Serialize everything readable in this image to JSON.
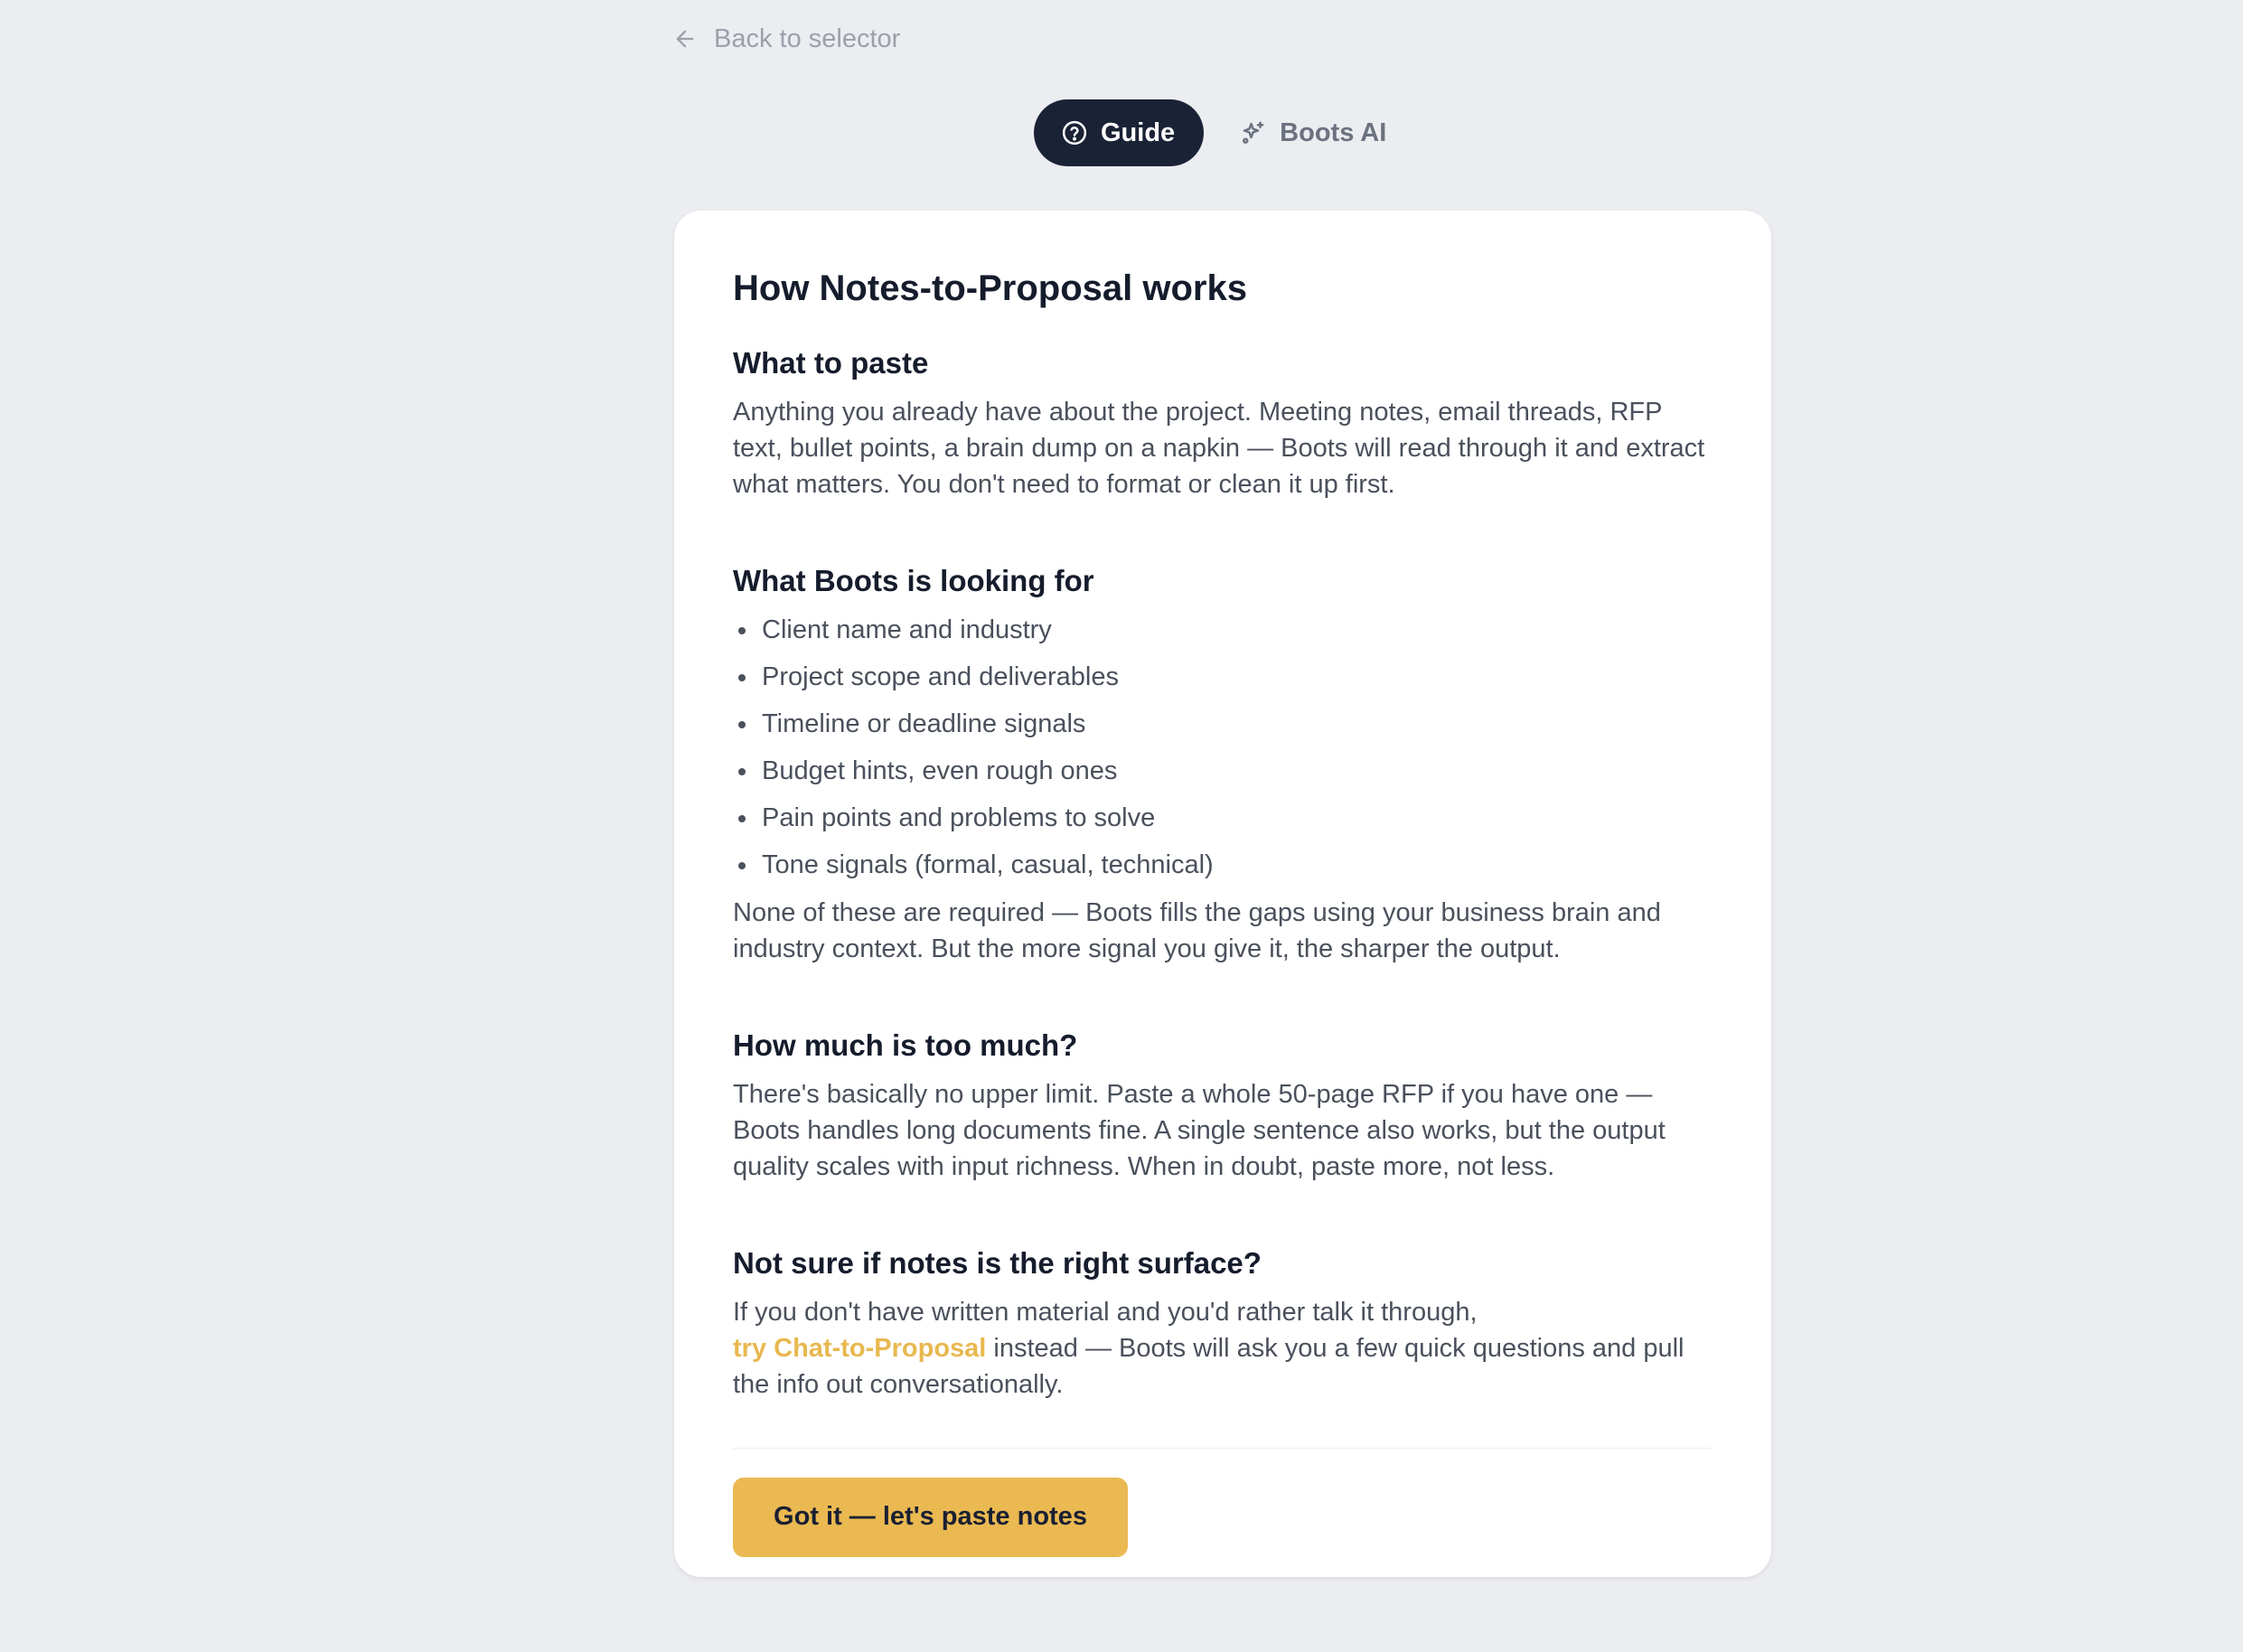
{
  "nav": {
    "back_label": "Back to selector"
  },
  "tabs": [
    {
      "label": "Guide",
      "icon": "question-circle-icon",
      "active": true
    },
    {
      "label": "Boots AI",
      "icon": "sparkles-icon",
      "active": false
    }
  ],
  "guide": {
    "title": "How Notes-to-Proposal works",
    "sections": {
      "paste": {
        "heading": "What to paste",
        "body": "Anything you already have about the project. Meeting notes, email threads, RFP text, bullet points, a brain dump on a napkin — Boots will read through it and extract what matters. You don't need to format or clean it up first."
      },
      "looking": {
        "heading": "What Boots is looking for",
        "items": [
          "Client name and industry",
          "Project scope and deliverables",
          "Timeline or deadline signals",
          "Budget hints, even rough ones",
          "Pain points and problems to solve",
          "Tone signals (formal, casual, technical)"
        ],
        "footer": "None of these are required — Boots fills the gaps using your business brain and industry context. But the more signal you give it, the sharper the output."
      },
      "much": {
        "heading": "How much is too much?",
        "body": "There's basically no upper limit. Paste a whole 50-page RFP if you have one — Boots handles long documents fine. A single sentence also works, but the output quality scales with input richness. When in doubt, paste more, not less."
      },
      "surface": {
        "heading": "Not sure if notes is the right surface?",
        "body_before": "If you don't have written material and you'd rather talk it through,",
        "link": "try Chat-to-Proposal",
        "body_after": " instead — Boots will ask you a few quick questions and pull the info out conversationally."
      }
    },
    "cta_label": "Got it — let's paste notes"
  },
  "colors": {
    "page_bg": "#ecedf1",
    "active_tab_bg": "#1a2235",
    "accent": "#ebb952",
    "link": "#e8b84f"
  }
}
